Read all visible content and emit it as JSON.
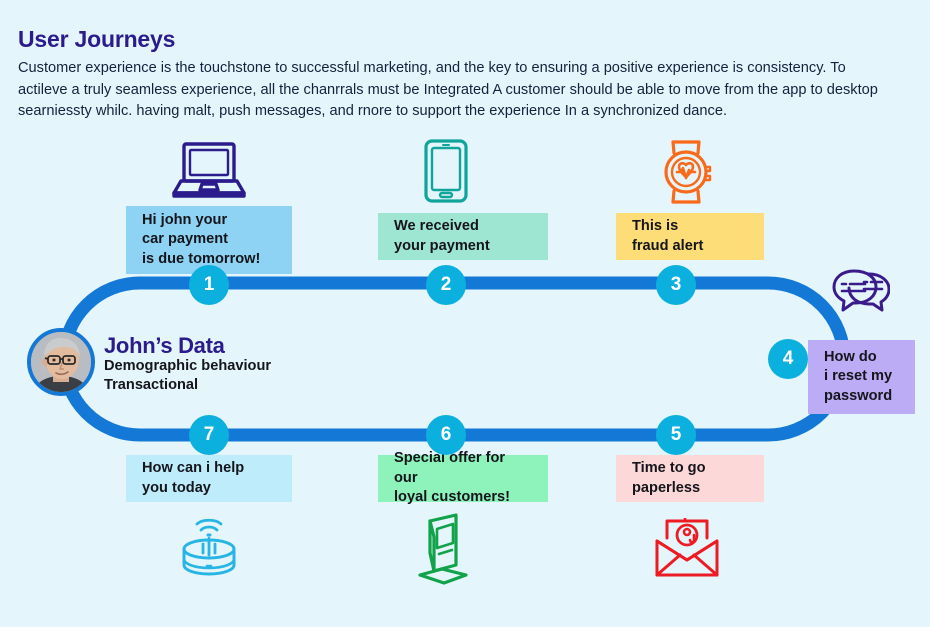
{
  "header": {
    "title": "User Journeys",
    "description": "Customer experience is the touchstone to successful marketing, and the key to ensuring a positive experience is consistency. To actileve a truly seamless experience, all the chanrrals must be Integrated A customer should be able to move from the app to desktop searniessty whilc. having malt, push messages, and rnore to support the experience In a synchronized dance."
  },
  "persona": {
    "name": "John’s Data",
    "attributes": "Demographic behaviour\nTransactional",
    "avatar_alt": "john-avatar"
  },
  "colors": {
    "background": "#e4f6fb",
    "track": "#1479d6",
    "node": "#0cb0de",
    "title": "#2b1b8c",
    "body_text": "#15151c",
    "box_1": "#8ed3f4",
    "box_2": "#9fe6d2",
    "box_3": "#fddd77",
    "box_4": "#bcabf5",
    "box_5": "#fdd8d8",
    "box_6": "#8ef3bb",
    "box_7": "#bfecfa",
    "icon_laptop": "#2b1b8c",
    "icon_phone": "#10a49b",
    "icon_watch": "#f96a1b",
    "icon_chat": "#3b1a8c",
    "icon_envelope": "#ed1c24",
    "icon_kiosk": "#11a24a",
    "icon_speaker": "#28b5e6"
  },
  "steps": [
    {
      "number": "1",
      "message": "Hi john your\ncar payment\nis due tomorrow!",
      "box_color": "#8ed3f4",
      "icon": "laptop-icon",
      "icon_color": "#2b1b8c"
    },
    {
      "number": "2",
      "message": "We received\nyour payment",
      "box_color": "#9fe6d2",
      "icon": "smartphone-icon",
      "icon_color": "#10a49b"
    },
    {
      "number": "3",
      "message": "This is\nfraud alert",
      "box_color": "#fddd77",
      "icon": "smartwatch-icon",
      "icon_color": "#f96a1b"
    },
    {
      "number": "4",
      "message": "How do\ni reset my\npassword",
      "box_color": "#bcabf5",
      "icon": "chat-bubbles-icon",
      "icon_color": "#3b1a8c"
    },
    {
      "number": "5",
      "message": "Time to go\npaperless",
      "box_color": "#fdd8d8",
      "icon": "email-envelope-icon",
      "icon_color": "#ed1c24"
    },
    {
      "number": "6",
      "message": "Special offer for our\nloyal customers!",
      "box_color": "#8ef3bb",
      "icon": "kiosk-terminal-icon",
      "icon_color": "#11a24a"
    },
    {
      "number": "7",
      "message": "How can i help\nyou today",
      "box_color": "#bfecfa",
      "icon": "smart-speaker-icon",
      "icon_color": "#28b5e6"
    }
  ]
}
